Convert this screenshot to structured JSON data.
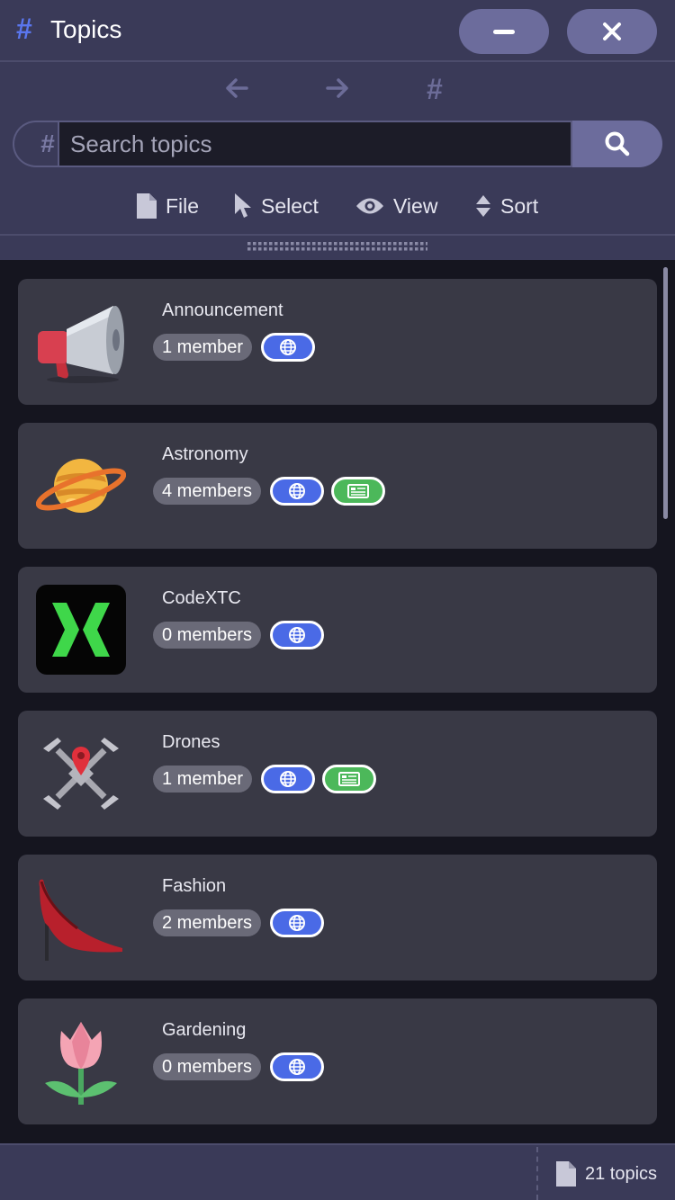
{
  "window": {
    "title": "Topics",
    "title_icon": "hash-icon",
    "minimize_icon": "minimize-icon",
    "close_icon": "close-icon"
  },
  "nav": {
    "back_icon": "arrow-left-icon",
    "forward_icon": "arrow-right-icon",
    "home_icon": "hash-icon"
  },
  "search": {
    "prefix_icon": "hash-icon",
    "placeholder": "Search topics",
    "value": "",
    "button_icon": "search-icon"
  },
  "menu": {
    "file": "File",
    "select": "Select",
    "view": "View",
    "sort": "Sort"
  },
  "topics": [
    {
      "name": "Announcement",
      "members": "1 member",
      "icon": "megaphone-icon",
      "badges": [
        "globe-icon"
      ]
    },
    {
      "name": "Astronomy",
      "members": "4 members",
      "icon": "planet-icon",
      "badges": [
        "globe-icon",
        "newspaper-icon"
      ]
    },
    {
      "name": "CodeXTC",
      "members": "0 members",
      "icon": "codextc-logo",
      "badges": [
        "globe-icon"
      ]
    },
    {
      "name": "Drones",
      "members": "1 member",
      "icon": "drone-icon",
      "badges": [
        "globe-icon",
        "newspaper-icon"
      ]
    },
    {
      "name": "Fashion",
      "members": "2 members",
      "icon": "high-heel-icon",
      "badges": [
        "globe-icon"
      ]
    },
    {
      "name": "Gardening",
      "members": "0 members",
      "icon": "tulip-icon",
      "badges": [
        "globe-icon"
      ]
    }
  ],
  "status": {
    "count": "21 topics",
    "icon": "file-icon"
  },
  "colors": {
    "accent": "#5a76ee",
    "panel": "#3a3a58",
    "card": "#393945",
    "badge_blue": "#4a6ae6",
    "badge_green": "#4cb85a"
  }
}
